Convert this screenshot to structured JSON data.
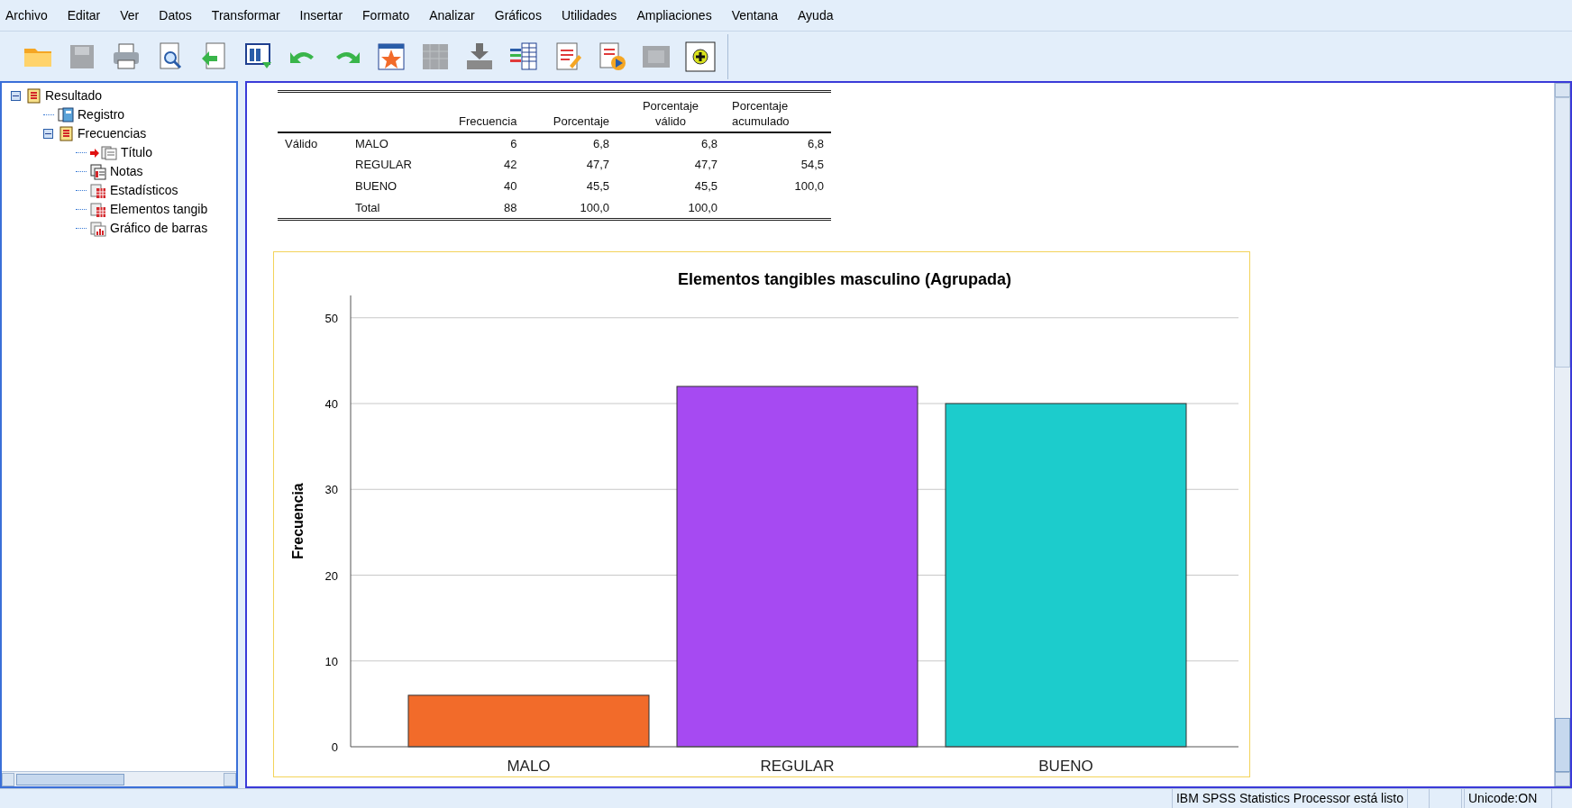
{
  "menu": [
    "Archivo",
    "Editar",
    "Ver",
    "Datos",
    "Transformar",
    "Insertar",
    "Formato",
    "Analizar",
    "Gráficos",
    "Utilidades",
    "Ampliaciones",
    "Ventana",
    "Ayuda"
  ],
  "toolbar": [
    {
      "kind": "open",
      "disabled": false
    },
    {
      "kind": "save",
      "disabled": true
    },
    {
      "kind": "print",
      "disabled": false
    },
    {
      "kind": "preview",
      "disabled": false
    },
    {
      "kind": "export",
      "disabled": false
    },
    {
      "kind": "recall",
      "disabled": false
    },
    {
      "kind": "undo",
      "disabled": false
    },
    {
      "kind": "redo",
      "disabled": false
    },
    {
      "kind": "goto",
      "disabled": false
    },
    {
      "kind": "gotocase",
      "disabled": true
    },
    {
      "kind": "insert",
      "disabled": false
    },
    {
      "kind": "variables",
      "disabled": false
    },
    {
      "kind": "edit",
      "disabled": false
    },
    {
      "kind": "run",
      "disabled": false
    },
    {
      "kind": "frame",
      "disabled": true
    },
    {
      "kind": "designate",
      "disabled": false
    }
  ],
  "outline": [
    {
      "label": "Resultado",
      "kind": "output",
      "current": false,
      "expanded": true,
      "children": [
        {
          "label": "Registro",
          "kind": "log",
          "current": false
        },
        {
          "label": "Frecuencias",
          "kind": "output",
          "current": false,
          "expanded": true,
          "children": [
            {
              "label": "Título",
              "kind": "title",
              "current": true
            },
            {
              "label": "Notas",
              "kind": "notes",
              "current": false
            },
            {
              "label": "Estadísticos",
              "kind": "table",
              "current": false
            },
            {
              "label": "Elementos tangib",
              "kind": "table",
              "current": false
            },
            {
              "label": "Gráfico de barras",
              "kind": "chart",
              "current": false
            }
          ]
        }
      ]
    }
  ],
  "table": {
    "columns": [
      "",
      "",
      "Frecuencia",
      "Porcentaje",
      "Porcentaje válido",
      "Porcentaje acumulado"
    ],
    "rows": [
      [
        "Válido",
        "MALO",
        "6",
        "6,8",
        "6,8",
        "6,8"
      ],
      [
        "",
        "REGULAR",
        "42",
        "47,7",
        "47,7",
        "54,5"
      ],
      [
        "",
        "BUENO",
        "40",
        "45,5",
        "45,5",
        "100,0"
      ],
      [
        "",
        "Total",
        "88",
        "100,0",
        "100,0",
        ""
      ]
    ]
  },
  "chart": {
    "chart_data": {
      "type": "bar",
      "title": "Elementos tangibles masculino (Agrupada)",
      "ylabel": "Frecuencia",
      "categories": [
        "MALO",
        "REGULAR",
        "BUENO"
      ],
      "values": [
        6,
        42,
        40
      ],
      "grid": true,
      "colors": [
        "#f26b2a",
        "#a64af2",
        "#1ccccc"
      ],
      "ylim": [
        0,
        52.6
      ],
      "yticks": [
        0,
        10,
        20,
        30,
        40,
        50
      ]
    }
  },
  "status_bar": [
    "IBM SPSS Statistics Processor está listo",
    "Unicode:ON"
  ]
}
